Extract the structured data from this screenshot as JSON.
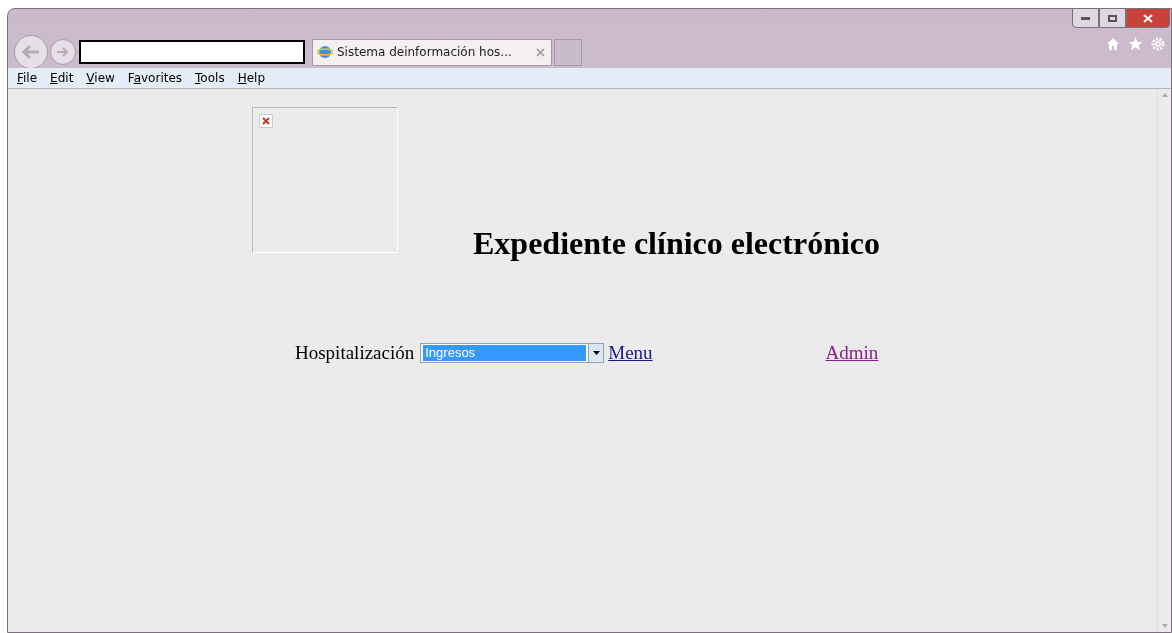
{
  "browser": {
    "tab": {
      "title": "Sistema deinformación hos...",
      "selected": true
    }
  },
  "menu": [
    {
      "label": "File"
    },
    {
      "label": "Edit"
    },
    {
      "label": "View"
    },
    {
      "label": "Favorites"
    },
    {
      "label": "Tools"
    },
    {
      "label": "Help"
    }
  ],
  "page": {
    "image": {
      "kind": "broken"
    },
    "title": "Expediente clínico electrónico",
    "form": {
      "label": "Hospitalización",
      "select": {
        "value": "Ingresos"
      }
    },
    "links": [
      {
        "label": "Menu",
        "visited": false
      },
      {
        "label": "Admin",
        "visited": true
      }
    ]
  }
}
